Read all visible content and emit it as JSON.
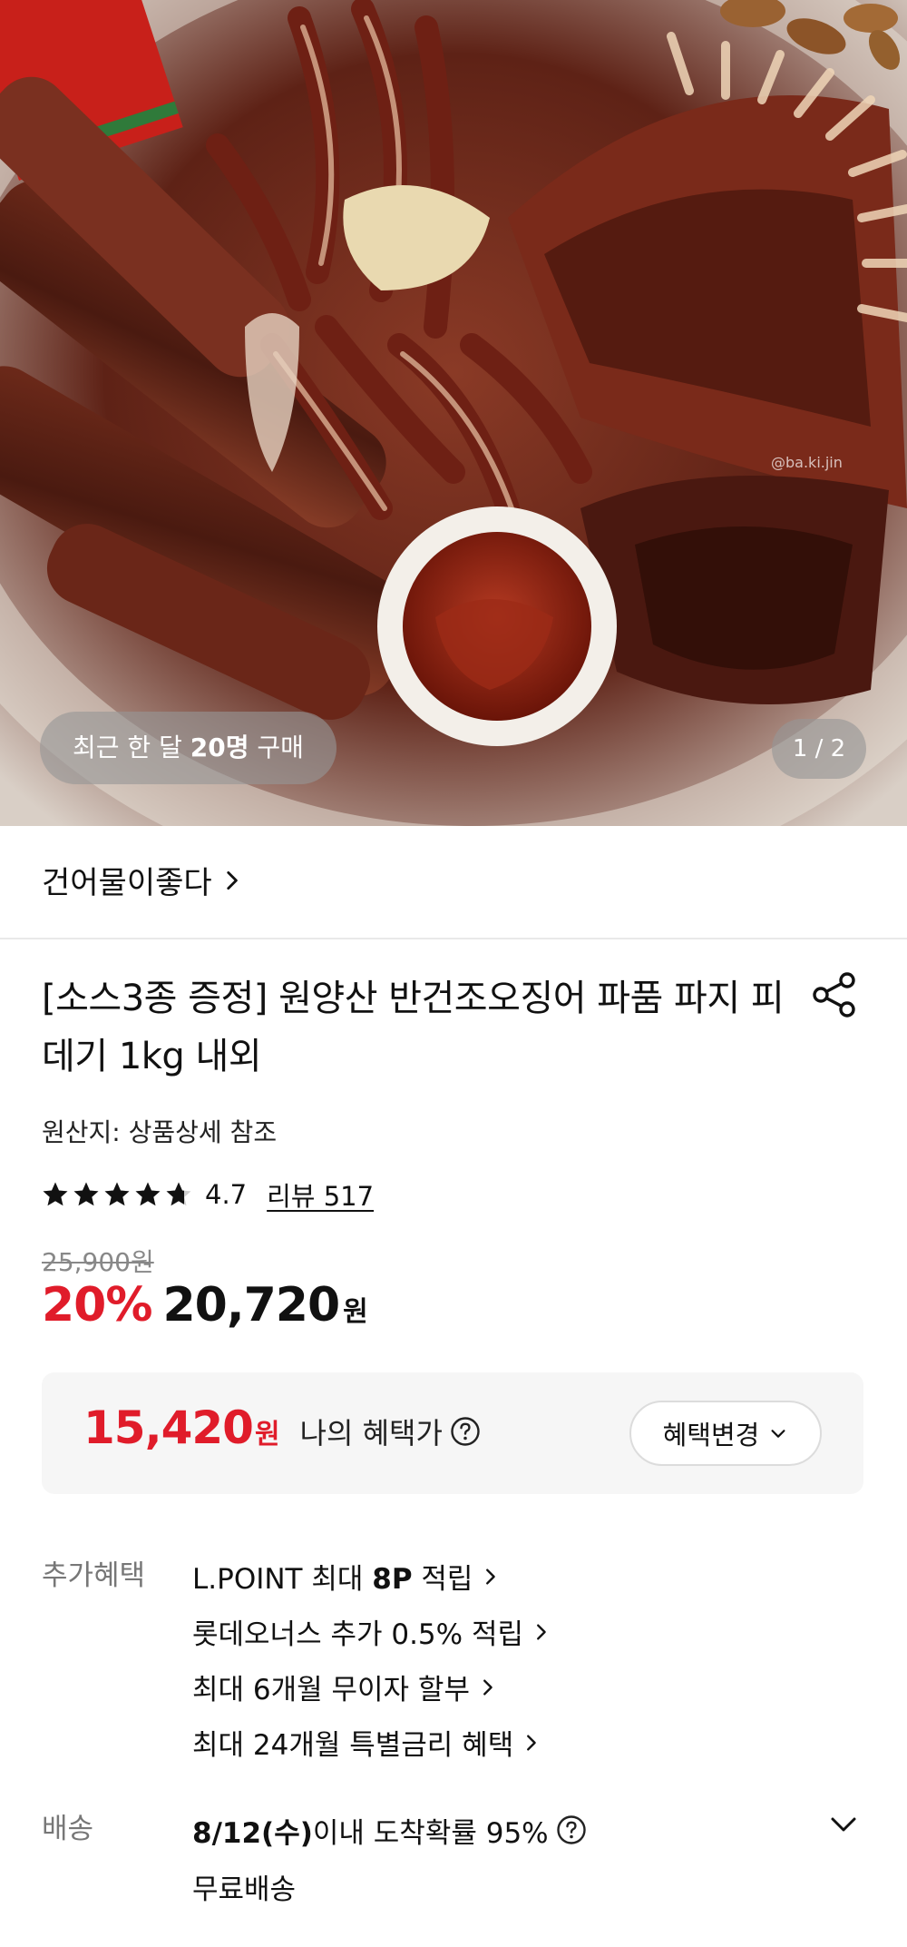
{
  "hero": {
    "image_alt": "grilled squid on a plate with dipping sauce",
    "recent_purchase_prefix": "최근 한 달 ",
    "recent_purchase_count": "20명",
    "recent_purchase_suffix": " 구매",
    "page_counter": "1 / 2"
  },
  "seller": {
    "name": "건어물이좋다"
  },
  "product": {
    "title": "[소스3종 증정] 원양산 반건조오징어 파품 파지 피데기 1kg 내외",
    "origin": "원산지: 상품상세 참조",
    "rating": "4.7",
    "stars": 4.7,
    "review_label": "리뷰 517",
    "original_price": "25,900원",
    "discount": "20%",
    "sale_price": "20,720",
    "price_unit": "원"
  },
  "benefit_box": {
    "my_price": "15,420",
    "my_price_unit": "원",
    "my_price_label": "나의 혜택가",
    "change_button": "혜택변경"
  },
  "additional_benefits": {
    "label": "추가혜택",
    "items": [
      {
        "prefix": "L.POINT 최대 ",
        "bold": "8P",
        "suffix": " 적립"
      },
      {
        "prefix": "롯데오너스 추가 0.5% 적립",
        "bold": "",
        "suffix": ""
      },
      {
        "prefix": "최대 6개월 무이자 할부",
        "bold": "",
        "suffix": ""
      },
      {
        "prefix": "최대 24개월 특별금리 혜택",
        "bold": "",
        "suffix": ""
      }
    ]
  },
  "delivery": {
    "label": "배송",
    "date": "8/12(수)",
    "probability": " 이내 도착확률 95%",
    "fee": "무료배송"
  },
  "colors": {
    "accent_red": "#e01c2a",
    "box_bg": "#f6f6f6"
  },
  "icons": {
    "share": "share-icon",
    "help": "question-circle-icon",
    "chevron_right": "chevron-right-icon",
    "chevron_down": "chevron-down-icon",
    "star": "star-icon"
  }
}
